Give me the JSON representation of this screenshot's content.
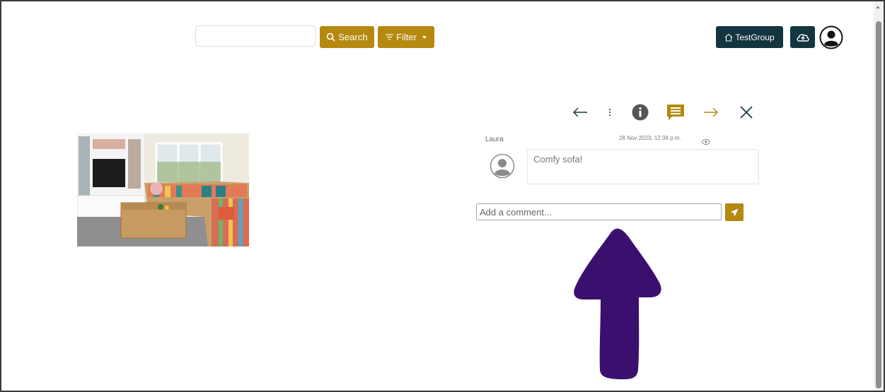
{
  "header": {
    "search_placeholder": "",
    "search_label": "Search",
    "filter_label": "Filter",
    "group_label": "TestGroup"
  },
  "comments": [
    {
      "author": "Laura",
      "timestamp": "28 Nov 2023, 12:38 p.m.",
      "text": "Comfy sofa!"
    }
  ],
  "comment_input": {
    "placeholder": "Add a comment..."
  },
  "colors": {
    "accent_gold": "#b5890f",
    "dark_button": "#12353f",
    "annotation_arrow": "#3b0f6e"
  },
  "icons": [
    "search-icon",
    "filter-icon",
    "home-icon",
    "cloud-upload-icon",
    "user-avatar-icon",
    "arrow-left-icon",
    "more-vertical-icon",
    "info-icon",
    "comment-icon",
    "arrow-right-icon",
    "close-icon",
    "eye-icon",
    "send-icon"
  ]
}
